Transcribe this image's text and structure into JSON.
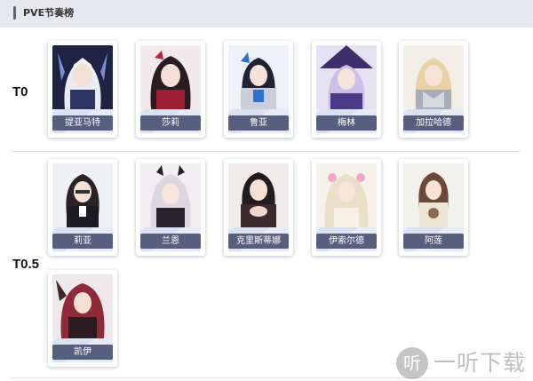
{
  "header": {
    "title": "PVE节奏榜"
  },
  "tiers": [
    {
      "label": "T0",
      "characters": [
        "提亚马特",
        "莎莉",
        "鲁亚",
        "梅林",
        "加拉哈德"
      ]
    },
    {
      "label": "T0.5",
      "characters": [
        "莉亚",
        "兰恩",
        "克里斯蒂娜",
        "伊索尔德",
        "阿莲",
        "凯伊"
      ]
    }
  ],
  "watermark": {
    "icon_char": "听",
    "text": "一听下载"
  },
  "colors": {
    "accent": "#5a6287",
    "name_plate": "#575f7e",
    "header_bg": "#e7e8ed"
  }
}
